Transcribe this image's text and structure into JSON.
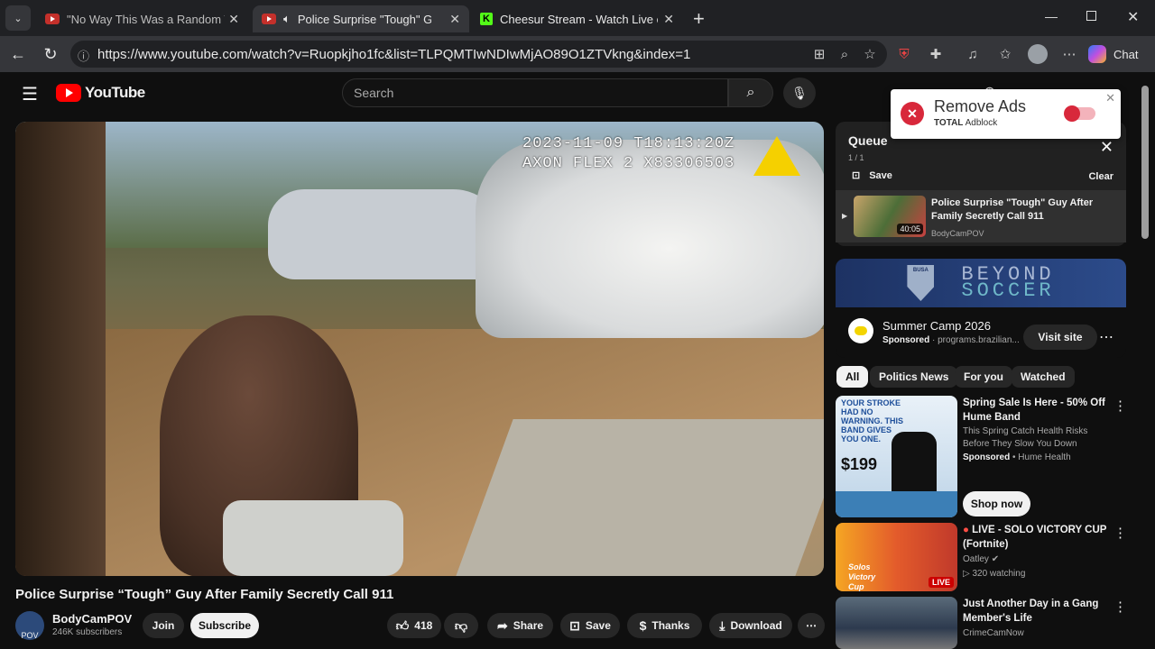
{
  "browser": {
    "tabs": [
      {
        "title": "\"No Way This Was a Random Traffi",
        "active": false
      },
      {
        "title": "Police Surprise \"Tough\" Guy A",
        "active": true
      },
      {
        "title": "Cheesur Stream - Watch Live on Ki",
        "active": false
      }
    ],
    "url": "https://www.youtube.com/watch?v=Ruopkjho1fc&list=TLPQMTIwNDIwMjAO89O1ZTVkng&index=1",
    "chat_label": "Chat"
  },
  "youtube": {
    "logo": "YouTube",
    "search_placeholder": "Search"
  },
  "video": {
    "stamp_line1": "2023-11-09 T18:13:20Z",
    "stamp_line2": "AXON FLEX 2 X83306503",
    "title": "Police Surprise “Tough” Guy After Family Secretly Call 911",
    "channel": "BodyCamPOV",
    "subscribers": "246K subscribers",
    "avatar_text": "POV",
    "join_label": "Join",
    "subscribe_label": "Subscribe",
    "likes": "418",
    "share_label": "Share",
    "save_label": "Save",
    "thanks_label": "Thanks",
    "download_label": "Download"
  },
  "queue": {
    "title": "Queue",
    "count": "1 / 1",
    "save_label": "Save",
    "clear_label": "Clear",
    "item": {
      "title": "Police Surprise \"Tough\" Guy After Family Secretly Call 911",
      "channel": "BodyCamPOV",
      "duration": "40:05"
    }
  },
  "ad": {
    "banner_line1": "BEYOND",
    "banner_line2": "SOCCER",
    "shield_text": "BUSA",
    "title": "Summer Camp 2026",
    "sponsored": "Sponsored",
    "domain": "programs.brazilian...",
    "visit_label": "Visit site"
  },
  "chips": [
    "All",
    "Politics News",
    "For you",
    "Watched"
  ],
  "recommendations": [
    {
      "title": "Spring Sale Is Here - 50% Off Hume Band",
      "desc": "This Spring Catch Health Risks Before They Slow You Down",
      "meta_bold": "Sponsored",
      "meta": " • Hume Health",
      "cta": "Shop now",
      "thumb_text1": "YOUR STROKE HAD NO WARNING. THIS BAND GIVES YOU ONE.",
      "thumb_price": "$199"
    },
    {
      "title": "LIVE - SOLO VICTORY CUP (Fortnite)",
      "channel": "Oatley",
      "meta": "320 watching",
      "badge": "LIVE",
      "thumb_text": "Solos Victory Cup"
    },
    {
      "title": "Just Another Day in a Gang Member's Life",
      "channel": "CrimeCamNow"
    }
  ],
  "adblock": {
    "title": "Remove Ads",
    "brand_bold": "TOTAL",
    "brand": " Adblock"
  }
}
